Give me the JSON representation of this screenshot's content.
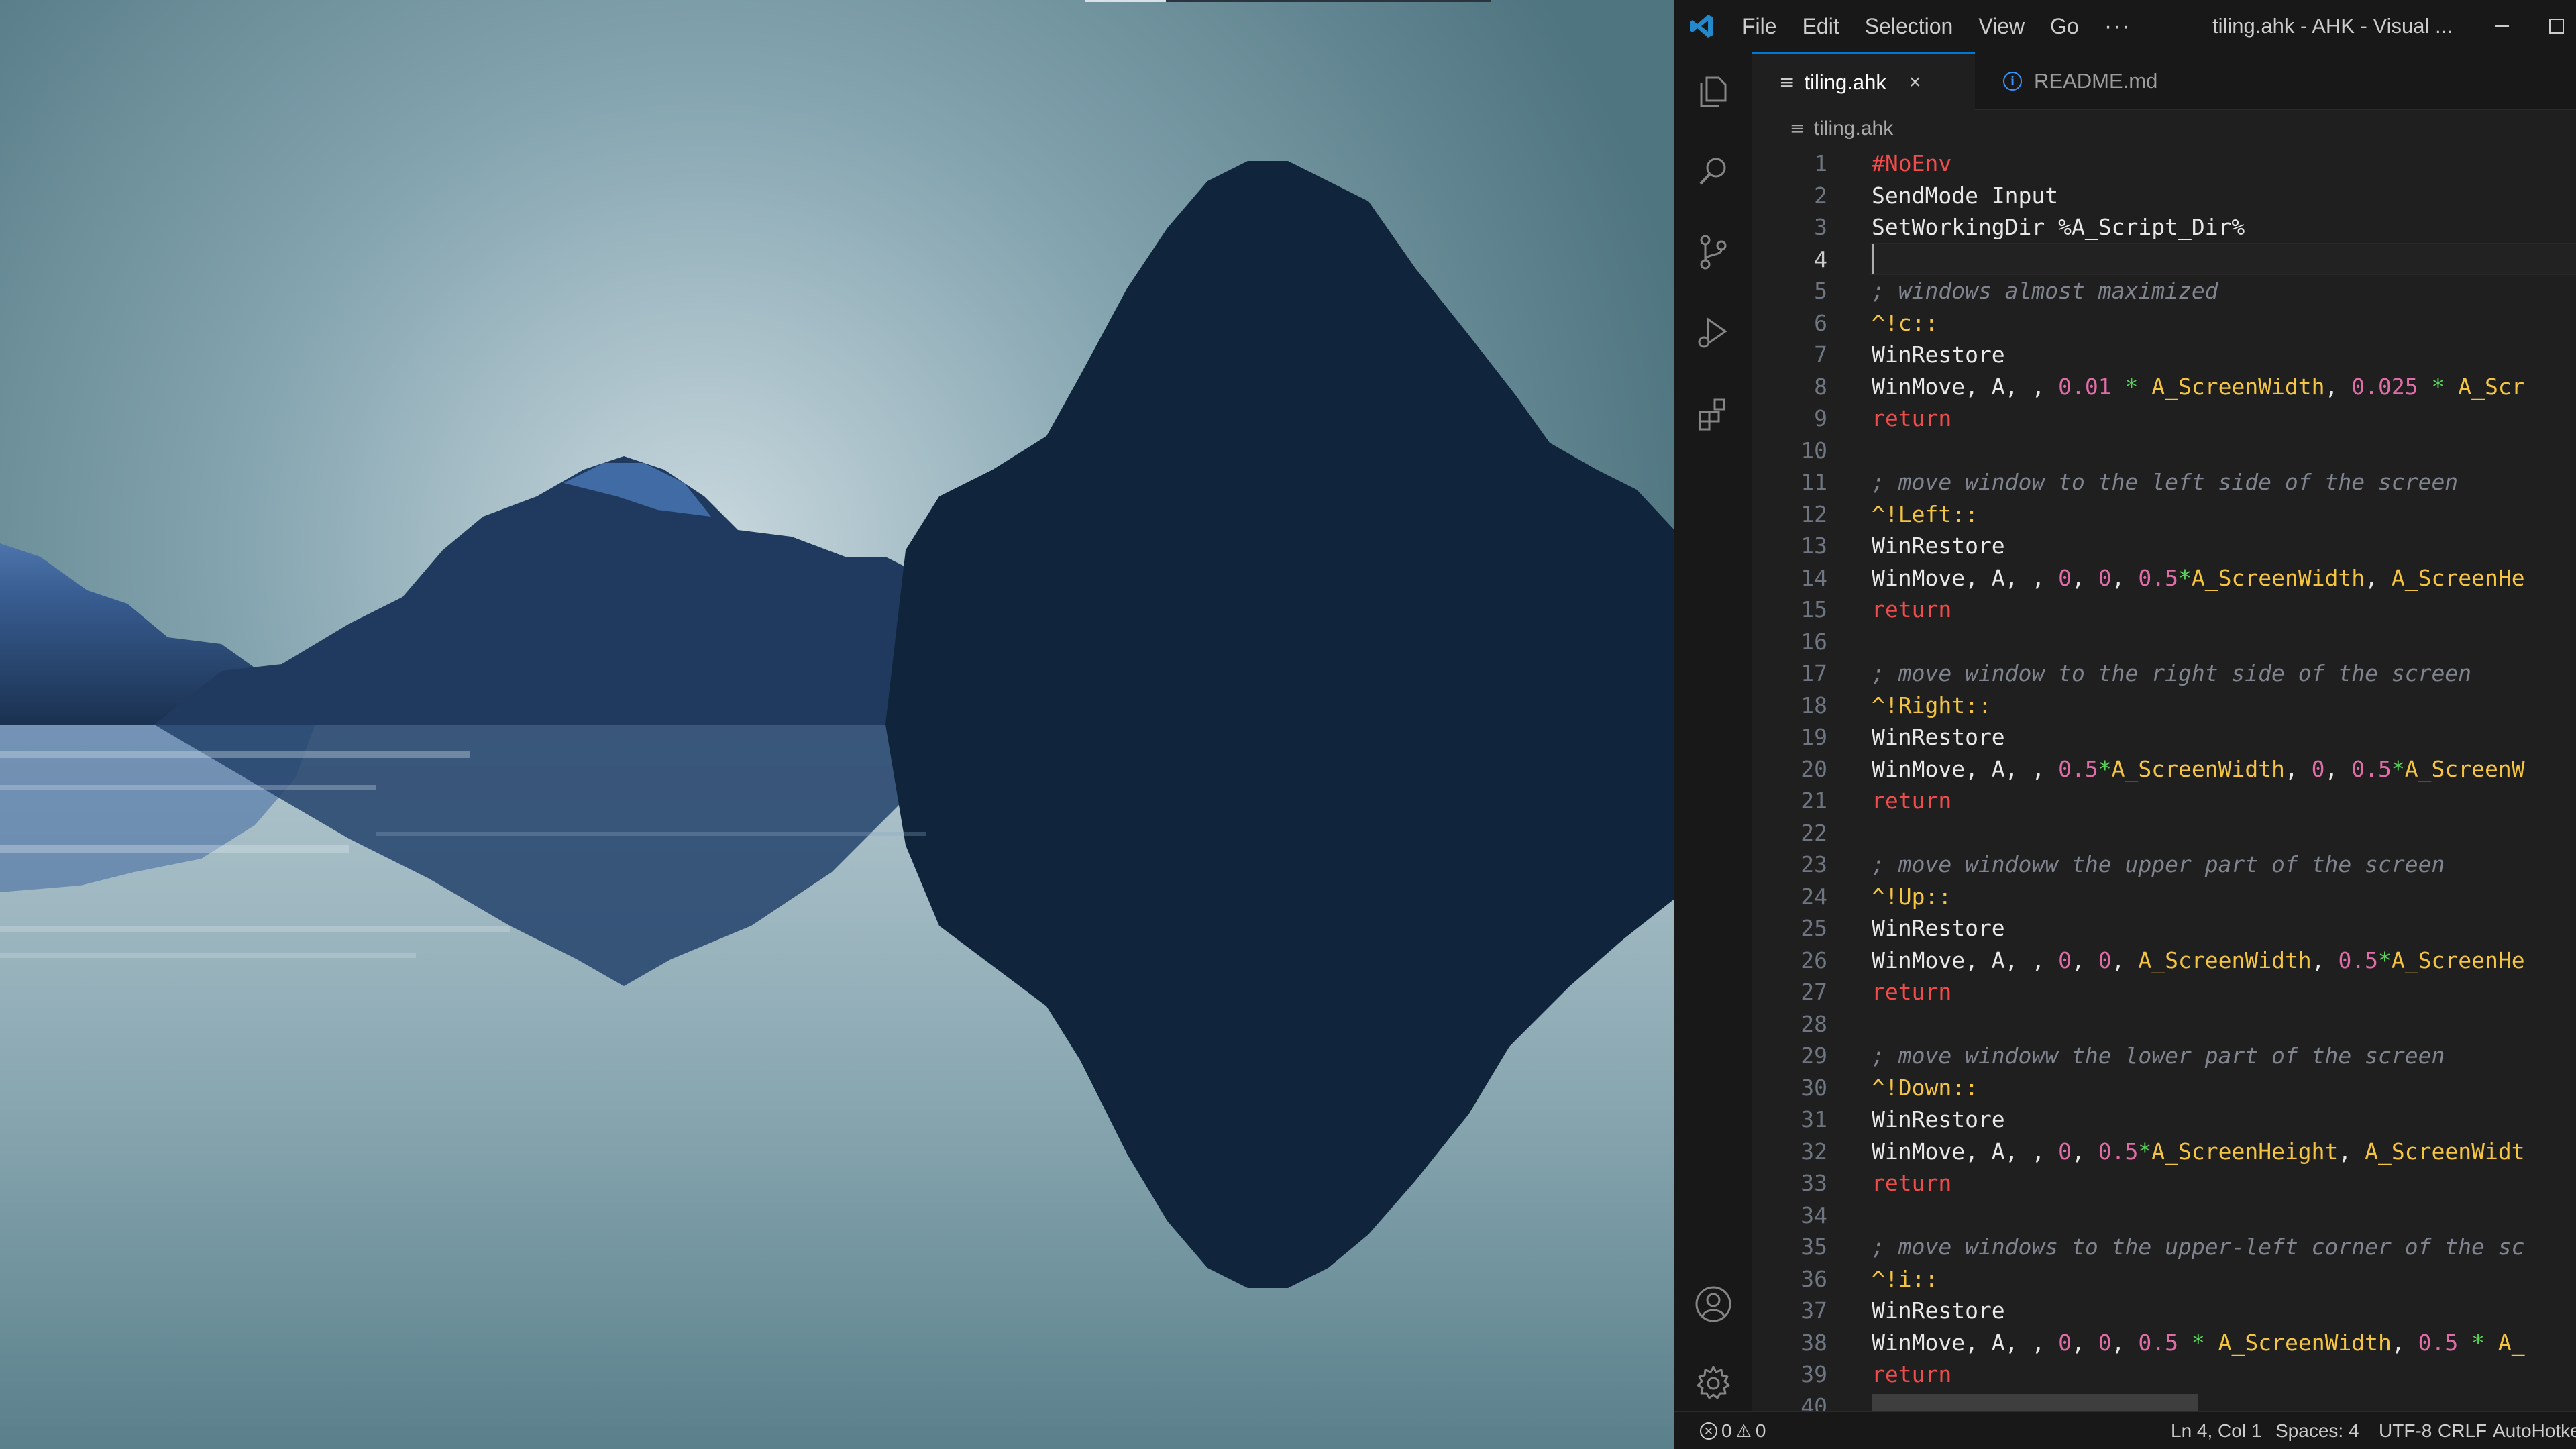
{
  "titlebar": {
    "menu": [
      "File",
      "Edit",
      "Selection",
      "View",
      "Go"
    ],
    "more": "···",
    "window_title": "tiling.ahk - AHK - Visual ...",
    "minimize": "–",
    "maximize": "□"
  },
  "tabs": [
    {
      "label": "tiling.ahk",
      "active": true,
      "close": "×"
    },
    {
      "label": "README.md",
      "active": false
    }
  ],
  "breadcrumb": "tiling.ahk",
  "editor": {
    "current_line": 4,
    "lines": [
      [
        {
          "t": "#NoEnv",
          "c": "pp"
        }
      ],
      [
        {
          "t": "SendMode Input",
          "c": "txt"
        }
      ],
      [
        {
          "t": "SetWorkingDir %A_Script_Dir%",
          "c": "txt"
        }
      ],
      [],
      [
        {
          "t": "; windows almost maximized",
          "c": "cm"
        }
      ],
      [
        {
          "t": "^!c::",
          "c": "lbl"
        }
      ],
      [
        {
          "t": "WinRestore",
          "c": "txt"
        }
      ],
      [
        {
          "t": "WinMove, A, , ",
          "c": "txt"
        },
        {
          "t": "0.01",
          "c": "num"
        },
        {
          "t": " * ",
          "c": "star"
        },
        {
          "t": "A_ScreenWidth",
          "c": "var"
        },
        {
          "t": ", ",
          "c": "txt"
        },
        {
          "t": "0.025",
          "c": "num"
        },
        {
          "t": " * ",
          "c": "star"
        },
        {
          "t": "A_Scr",
          "c": "var"
        }
      ],
      [
        {
          "t": "return",
          "c": "kw"
        }
      ],
      [],
      [
        {
          "t": "; move window to the left side of the screen",
          "c": "cm"
        }
      ],
      [
        {
          "t": "^!Left::",
          "c": "lbl"
        }
      ],
      [
        {
          "t": "WinRestore",
          "c": "txt"
        }
      ],
      [
        {
          "t": "WinMove, A, , ",
          "c": "txt"
        },
        {
          "t": "0",
          "c": "num"
        },
        {
          "t": ", ",
          "c": "txt"
        },
        {
          "t": "0",
          "c": "num"
        },
        {
          "t": ", ",
          "c": "txt"
        },
        {
          "t": "0.5",
          "c": "num"
        },
        {
          "t": "*",
          "c": "star"
        },
        {
          "t": "A_ScreenWidth",
          "c": "var"
        },
        {
          "t": ", ",
          "c": "txt"
        },
        {
          "t": "A_ScreenHe",
          "c": "var"
        }
      ],
      [
        {
          "t": "return",
          "c": "kw"
        }
      ],
      [],
      [
        {
          "t": "; move window to the right side of the screen",
          "c": "cm"
        }
      ],
      [
        {
          "t": "^!Right::",
          "c": "lbl"
        }
      ],
      [
        {
          "t": "WinRestore",
          "c": "txt"
        }
      ],
      [
        {
          "t": "WinMove, A, , ",
          "c": "txt"
        },
        {
          "t": "0.5",
          "c": "num"
        },
        {
          "t": "*",
          "c": "star"
        },
        {
          "t": "A_ScreenWidth",
          "c": "var"
        },
        {
          "t": ", ",
          "c": "txt"
        },
        {
          "t": "0",
          "c": "num"
        },
        {
          "t": ", ",
          "c": "txt"
        },
        {
          "t": "0.5",
          "c": "num"
        },
        {
          "t": "*",
          "c": "star"
        },
        {
          "t": "A_ScreenW",
          "c": "var"
        }
      ],
      [
        {
          "t": "return",
          "c": "kw"
        }
      ],
      [],
      [
        {
          "t": "; move windoww the upper part of the screen",
          "c": "cm"
        }
      ],
      [
        {
          "t": "^!Up::",
          "c": "lbl"
        }
      ],
      [
        {
          "t": "WinRestore",
          "c": "txt"
        }
      ],
      [
        {
          "t": "WinMove, A, , ",
          "c": "txt"
        },
        {
          "t": "0",
          "c": "num"
        },
        {
          "t": ", ",
          "c": "txt"
        },
        {
          "t": "0",
          "c": "num"
        },
        {
          "t": ", ",
          "c": "txt"
        },
        {
          "t": "A_ScreenWidth",
          "c": "var"
        },
        {
          "t": ", ",
          "c": "txt"
        },
        {
          "t": "0.5",
          "c": "num"
        },
        {
          "t": "*",
          "c": "star"
        },
        {
          "t": "A_ScreenHe",
          "c": "var"
        }
      ],
      [
        {
          "t": "return",
          "c": "kw"
        }
      ],
      [],
      [
        {
          "t": "; move windoww the lower part of the screen",
          "c": "cm"
        }
      ],
      [
        {
          "t": "^!Down::",
          "c": "lbl"
        }
      ],
      [
        {
          "t": "WinRestore",
          "c": "txt"
        }
      ],
      [
        {
          "t": "WinMove, A, , ",
          "c": "txt"
        },
        {
          "t": "0",
          "c": "num"
        },
        {
          "t": ", ",
          "c": "txt"
        },
        {
          "t": "0.5",
          "c": "num"
        },
        {
          "t": "*",
          "c": "star"
        },
        {
          "t": "A_ScreenHeight",
          "c": "var"
        },
        {
          "t": ", ",
          "c": "txt"
        },
        {
          "t": "A_ScreenWidt",
          "c": "var"
        }
      ],
      [
        {
          "t": "return",
          "c": "kw"
        }
      ],
      [],
      [
        {
          "t": "; move windows to the upper-left corner of the sc",
          "c": "cm"
        }
      ],
      [
        {
          "t": "^!i::",
          "c": "lbl"
        }
      ],
      [
        {
          "t": "WinRestore",
          "c": "txt"
        }
      ],
      [
        {
          "t": "WinMove, A, , ",
          "c": "txt"
        },
        {
          "t": "0",
          "c": "num"
        },
        {
          "t": ", ",
          "c": "txt"
        },
        {
          "t": "0",
          "c": "num"
        },
        {
          "t": ", ",
          "c": "txt"
        },
        {
          "t": "0.5",
          "c": "num"
        },
        {
          "t": " * ",
          "c": "star"
        },
        {
          "t": "A_ScreenWidth",
          "c": "var"
        },
        {
          "t": ", ",
          "c": "txt"
        },
        {
          "t": "0.5",
          "c": "num"
        },
        {
          "t": " * ",
          "c": "star"
        },
        {
          "t": "A_",
          "c": "var"
        }
      ],
      [
        {
          "t": "return",
          "c": "kw"
        }
      ],
      []
    ]
  },
  "status": {
    "errors": "0",
    "warnings": "0",
    "position": "Ln 4, Col 1",
    "spaces": "Spaces: 4",
    "encoding": "UTF-8",
    "eol": "CRLF",
    "language": "AutoHotkey"
  },
  "colors": {
    "accent": "#0078d4",
    "editor_bg": "#1f1f1f",
    "chrome_bg": "#181818",
    "wallpaper_sky": "#5f8591",
    "mountain": "#0f2338"
  }
}
